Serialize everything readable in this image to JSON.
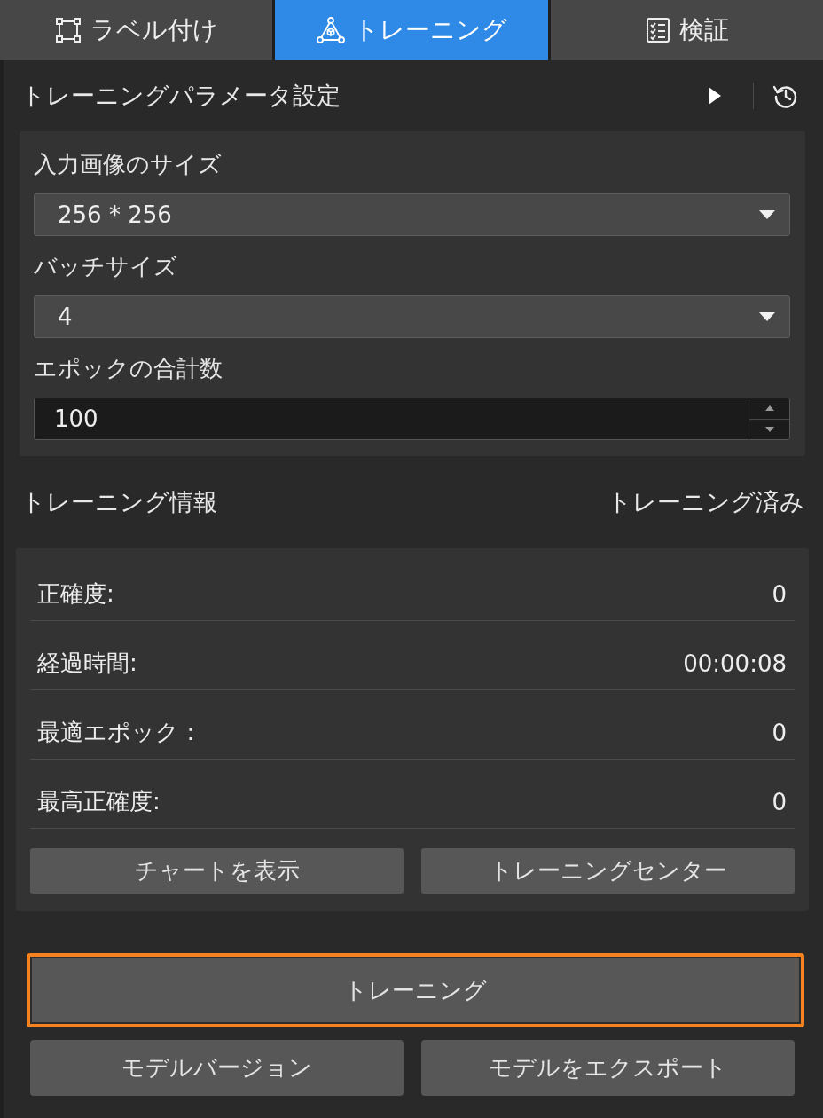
{
  "tabs": [
    {
      "label": "ラベル付け",
      "kind": "annotate",
      "selected": false
    },
    {
      "label": "トレーニング",
      "kind": "train",
      "selected": true
    },
    {
      "label": "検証",
      "kind": "verify",
      "selected": false
    }
  ],
  "parameters": {
    "title": "トレーニングパラメータ設定",
    "fields": [
      {
        "kind": "dropdown",
        "label": "入力画像のサイズ",
        "value": "256 * 256"
      },
      {
        "kind": "dropdown",
        "label": "バッチサイズ",
        "value": "4"
      },
      {
        "kind": "spinbox",
        "label": "エポックの合計数",
        "value": "100"
      }
    ]
  },
  "training_info": {
    "title": "トレーニング情報",
    "status": "トレーニング済み",
    "rows": [
      {
        "label": "正確度:",
        "value": "0"
      },
      {
        "label": "経過時間:",
        "value": "00:00:08"
      },
      {
        "label": "最適エポック：",
        "value": "0"
      },
      {
        "label": "最高正確度:",
        "value": "0"
      }
    ],
    "buttons": [
      "チャートを表示",
      "トレーニングセンター"
    ]
  },
  "train_button": {
    "label": "トレーニング",
    "highlighted": true
  },
  "bottom_buttons": [
    "モデルバージョン",
    "モデルをエクスポート"
  ]
}
